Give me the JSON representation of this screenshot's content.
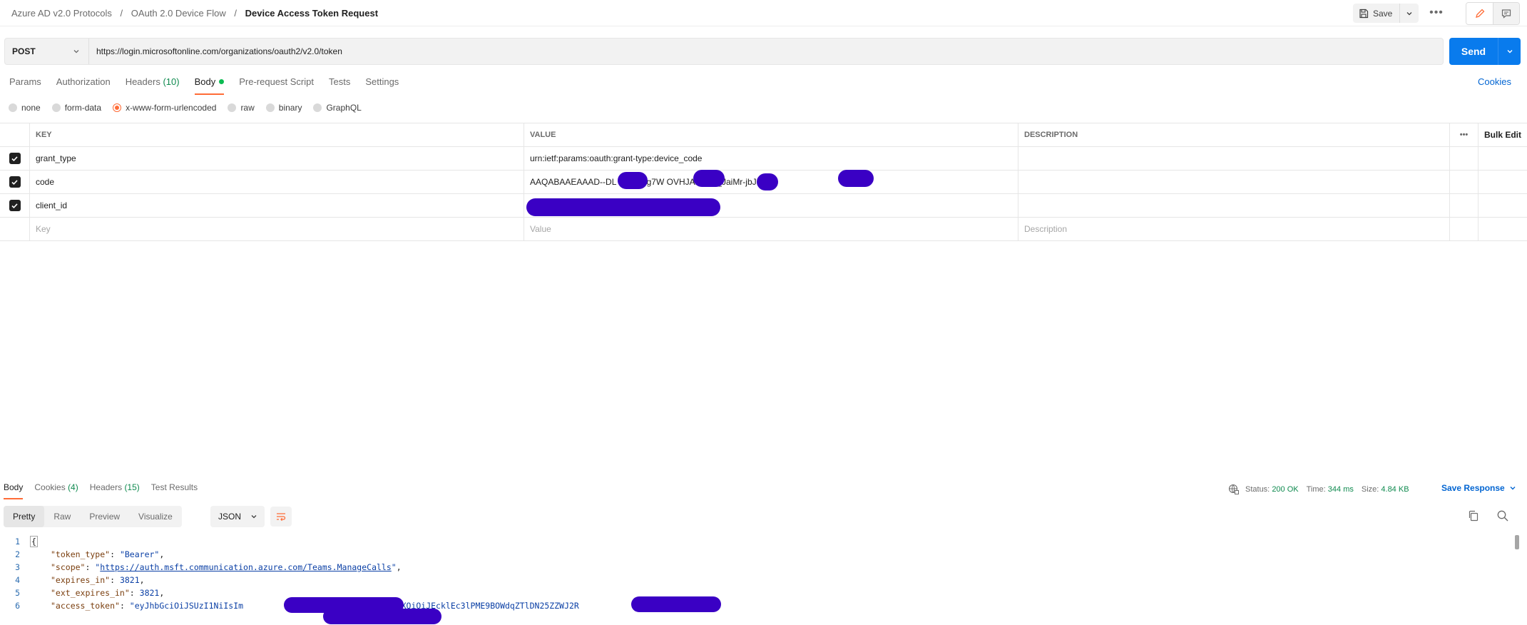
{
  "breadcrumb": {
    "items": [
      "Azure AD v2.0 Protocols",
      "OAuth 2.0 Device Flow"
    ],
    "current": "Device Access Token Request",
    "separator": "/"
  },
  "toolbar": {
    "save_label": "Save",
    "more_label": "•••"
  },
  "request": {
    "method": "POST",
    "url": "https://login.microsoftonline.com/organizations/oauth2/v2.0/token",
    "send_label": "Send"
  },
  "request_tabs": [
    {
      "label": "Params",
      "count": "",
      "active": false
    },
    {
      "label": "Authorization",
      "count": "",
      "active": false
    },
    {
      "label": "Headers",
      "count": "(10)",
      "active": false
    },
    {
      "label": "Body",
      "count": "",
      "active": true
    },
    {
      "label": "Pre-request Script",
      "count": "",
      "active": false
    },
    {
      "label": "Tests",
      "count": "",
      "active": false
    },
    {
      "label": "Settings",
      "count": "",
      "active": false
    }
  ],
  "cookies_label": "Cookies",
  "body_types": [
    {
      "label": "none",
      "selected": false
    },
    {
      "label": "form-data",
      "selected": false
    },
    {
      "label": "x-www-form-urlencoded",
      "selected": true
    },
    {
      "label": "raw",
      "selected": false
    },
    {
      "label": "binary",
      "selected": false
    },
    {
      "label": "GraphQL",
      "selected": false
    }
  ],
  "params_table": {
    "headers": {
      "key": "KEY",
      "value": "VALUE",
      "description": "DESCRIPTION",
      "more": "•••",
      "bulk_edit": "Bulk Edit"
    },
    "rows": [
      {
        "checked": true,
        "key": "grant_type",
        "value": "urn:ietf:params:oauth:grant-type:device_code",
        "description": ""
      },
      {
        "checked": true,
        "key": "code",
        "value": "AAQABAAEAAAD--DL        QrddgJg7W         OVHJAr       uzjY_JaiMr-jbJK",
        "description": ""
      },
      {
        "checked": true,
        "key": "client_id",
        "value": "",
        "description": ""
      }
    ],
    "placeholders": {
      "key": "Key",
      "value": "Value",
      "description": "Description"
    }
  },
  "response": {
    "tabs": [
      {
        "label": "Body",
        "count": "",
        "active": true
      },
      {
        "label": "Cookies",
        "count": "(4)",
        "active": false
      },
      {
        "label": "Headers",
        "count": "(15)",
        "active": false
      },
      {
        "label": "Test Results",
        "count": "",
        "active": false
      }
    ],
    "status_label": "Status:",
    "status_value": "200 OK",
    "time_label": "Time:",
    "time_value": "344 ms",
    "size_label": "Size:",
    "size_value": "4.84 KB",
    "save_response_label": "Save Response",
    "views": [
      "Pretty",
      "Raw",
      "Preview",
      "Visualize"
    ],
    "active_view": "Pretty",
    "format": "JSON"
  },
  "response_json": {
    "line_numbers": [
      "1",
      "2",
      "3",
      "4",
      "5",
      "6"
    ],
    "open_brace": "{",
    "token_type_key": "\"token_type\"",
    "token_type_value": "\"Bearer\"",
    "scope_key": "\"scope\"",
    "scope_value": "https://auth.msft.communication.azure.com/Teams.ManageCalls",
    "expires_in_key": "\"expires_in\"",
    "expires_in_value": "3821",
    "ext_expires_in_key": "\"ext_expires_in\"",
    "ext_expires_in_value": "3821",
    "access_token_key": "\"access_token\"",
    "access_token_value": "\"eyJhbGciOiJSUzI1NiIsIm                        TYiLCJ4NXQiOiJEcklEc3lPME9BOWdqZTlDN25ZZWJ2R                 JERUYifQ."
  },
  "colors": {
    "accent": "#ff6c37",
    "send": "#097bed",
    "link": "#0265d2",
    "success": "#0f8a4f",
    "redaction": "#3a00c4"
  },
  "icons": [
    "save-icon",
    "chevron-down-icon",
    "more-icon",
    "edit-icon",
    "comment-icon",
    "globe-icon",
    "wrap-icon",
    "copy-icon",
    "search-icon",
    "check-icon"
  ]
}
